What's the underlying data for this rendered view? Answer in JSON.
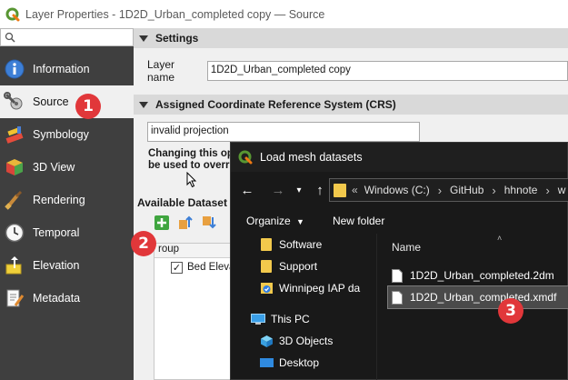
{
  "window": {
    "title": "Layer Properties - 1D2D_Urban_completed copy — Source"
  },
  "sidebar": {
    "search_placeholder": "",
    "items": [
      {
        "label": "Information"
      },
      {
        "label": "Source"
      },
      {
        "label": "Symbology"
      },
      {
        "label": "3D View"
      },
      {
        "label": "Rendering"
      },
      {
        "label": "Temporal"
      },
      {
        "label": "Elevation"
      },
      {
        "label": "Metadata"
      }
    ]
  },
  "settings": {
    "header": "Settings",
    "layer_name_label": "Layer name",
    "layer_name_value": "1D2D_Urban_completed copy"
  },
  "crs": {
    "header": "Assigned Coordinate Reference System (CRS)",
    "value": "invalid projection",
    "warning_line1": "Changing this op",
    "warning_line2": "be used to overr"
  },
  "datasets": {
    "title": "Available Dataset",
    "group_col": "roup",
    "row_label": "Bed Eleva",
    "row_checked": true
  },
  "badges": {
    "one": "1",
    "two": "2",
    "three": "3"
  },
  "dialog": {
    "title": "Load mesh datasets",
    "breadcrumb_prefix": "«",
    "breadcrumb": [
      "Windows (C:)",
      "GitHub",
      "hhnote",
      "w"
    ],
    "organize_label": "Organize",
    "new_folder_label": "New folder",
    "name_header": "Name",
    "left_items": [
      {
        "label": "Software",
        "icon": "folder-icon"
      },
      {
        "label": "Support",
        "icon": "folder-icon"
      },
      {
        "label": "Winnipeg IAP da",
        "icon": "onedrive-folder-icon"
      },
      {
        "label": "This PC",
        "icon": "monitor-icon"
      },
      {
        "label": "3D Objects",
        "icon": "cube-icon"
      },
      {
        "label": "Desktop",
        "icon": "desktop-icon"
      }
    ],
    "files": [
      {
        "label": "1D2D_Urban_completed.2dm",
        "selected": false
      },
      {
        "label": "1D2D_Urban_completed.xmdf",
        "selected": true
      }
    ]
  }
}
